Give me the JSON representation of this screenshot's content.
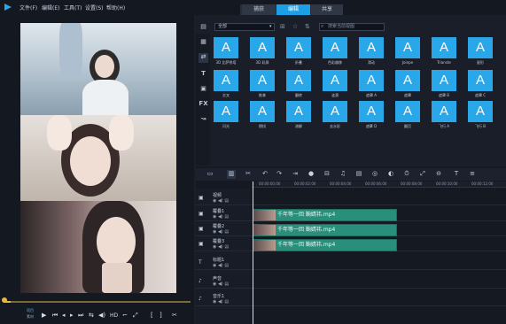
{
  "menu": {
    "items": [
      "文件(F)",
      "编辑(E)",
      "工具(T)",
      "设置(S)",
      "帮助(H)"
    ]
  },
  "steps": {
    "capture": "捕获",
    "edit": "编辑",
    "share": "共享"
  },
  "library": {
    "gallery_value": "全部",
    "search_placeholder": "搜索当前视图",
    "tiles": [
      {
        "letter": "A",
        "label": "3D 比萨饼塔"
      },
      {
        "letter": "A",
        "label": "3D 彩屏"
      },
      {
        "letter": "A",
        "label": "折叠"
      },
      {
        "letter": "A",
        "label": "色彩偏移"
      },
      {
        "letter": "A",
        "label": "滑动"
      },
      {
        "letter": "A",
        "label": "Joinpe"
      },
      {
        "letter": "A",
        "label": "Trianste"
      },
      {
        "letter": "A",
        "label": "星形"
      },
      {
        "letter": "A",
        "label": "交叉"
      },
      {
        "letter": "A",
        "label": "推拿"
      },
      {
        "letter": "A",
        "label": "翻转"
      },
      {
        "letter": "A",
        "label": "涟漪"
      },
      {
        "letter": "A",
        "label": "遮罩 A"
      },
      {
        "letter": "A",
        "label": "遮罩"
      },
      {
        "letter": "A",
        "label": "遮罩 B"
      },
      {
        "letter": "A",
        "label": "遮罩 C"
      },
      {
        "letter": "A",
        "label": "闪光"
      },
      {
        "letter": "A",
        "label": "擦拭"
      },
      {
        "letter": "A",
        "label": "溶解"
      },
      {
        "letter": "A",
        "label": "去水彩"
      },
      {
        "letter": "A",
        "label": "遮罩 D"
      },
      {
        "letter": "A",
        "label": "翻页"
      },
      {
        "letter": "A",
        "label": "飞行 A"
      },
      {
        "letter": "A",
        "label": "飞行 B"
      }
    ]
  },
  "timeline": {
    "ruler": [
      "00:00:00:00",
      "00:00:02:00",
      "00:00:04:00",
      "00:00:06:00",
      "00:00:08:00",
      "00:00:10:00",
      "00:00:12:00"
    ],
    "tracks": [
      {
        "name": "视频"
      },
      {
        "name": "覆叠1"
      },
      {
        "name": "覆叠2"
      },
      {
        "name": "覆叠3"
      },
      {
        "name": "标题1"
      },
      {
        "name": "声音"
      },
      {
        "name": "音乐1"
      }
    ],
    "clips": [
      {
        "label": "千年等一回 鞠婧祎.mp4"
      },
      {
        "label": "千年等一回 鞠婧祎.mp4"
      },
      {
        "label": "千年等一回 鞠婧祎.mp4"
      }
    ]
  },
  "player": {
    "project_label": "项目",
    "clip_label": "素材"
  }
}
